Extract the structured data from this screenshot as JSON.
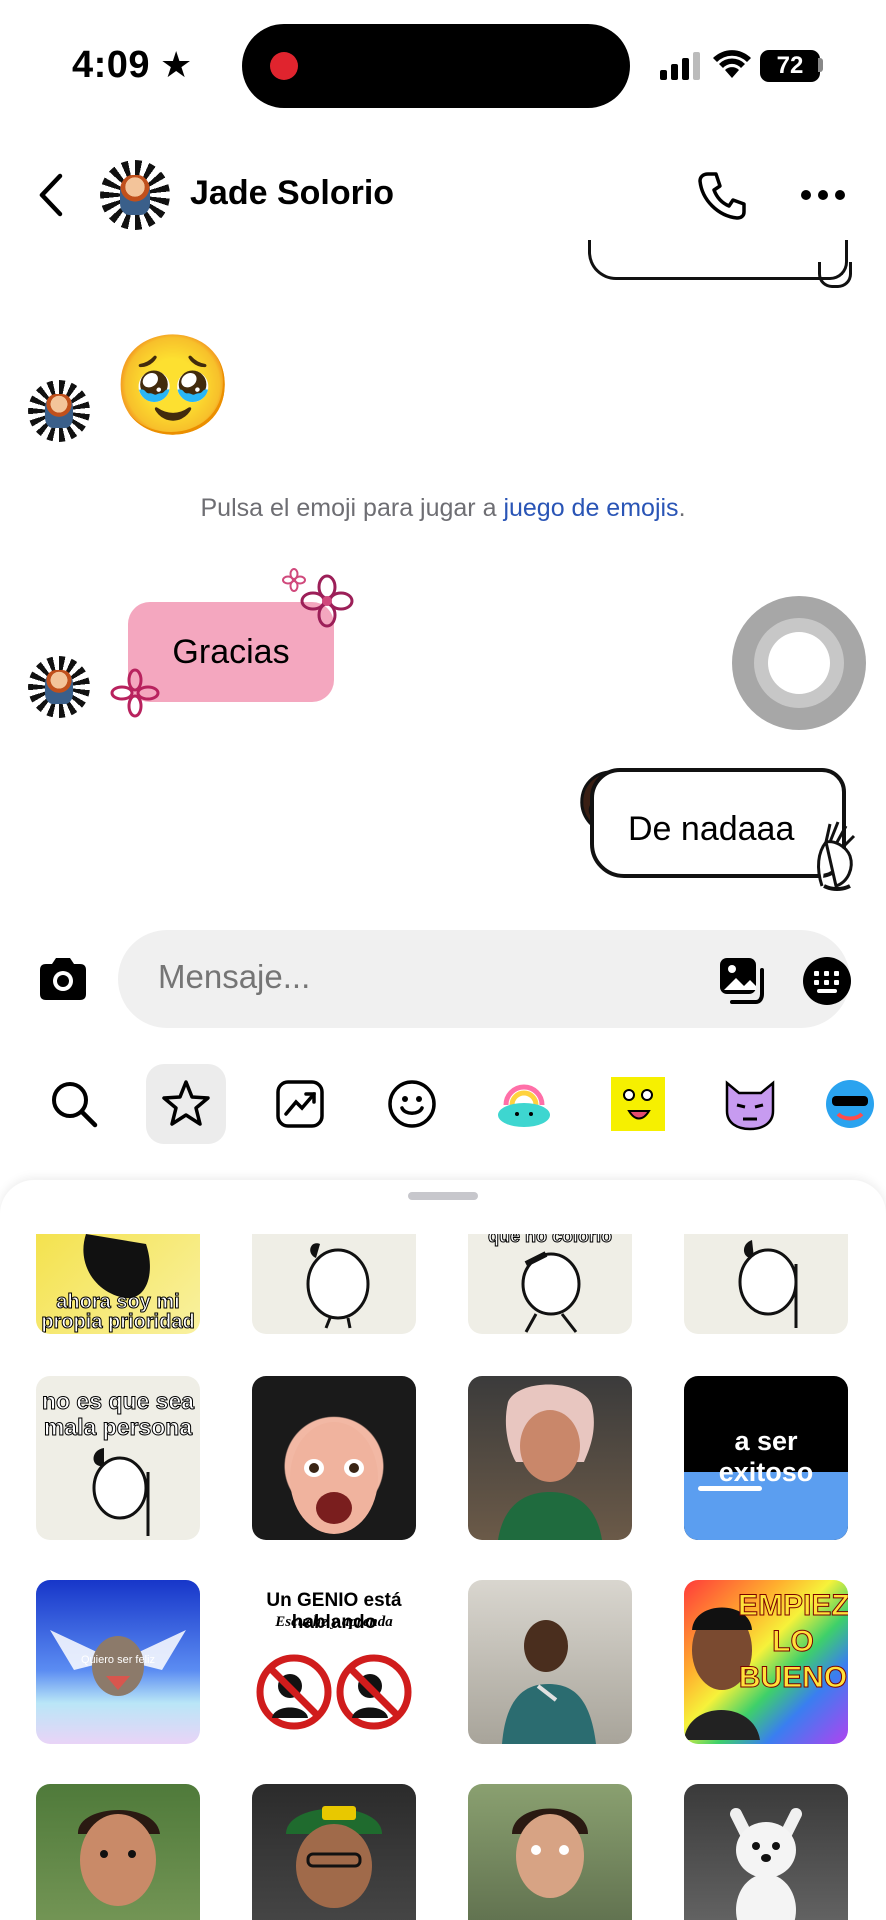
{
  "status_bar": {
    "time": "4:09",
    "battery": "72"
  },
  "header": {
    "contact_name": "Jade Solorio"
  },
  "messages": {
    "received_emoji": "🥹",
    "hint_prefix": "Pulsa el emoji para jugar a ",
    "hint_link": "juego de emojis",
    "hint_suffix": ".",
    "received_text": "Gracias",
    "sent_text": "De nadaaa"
  },
  "composer": {
    "placeholder": "Mensaje..."
  },
  "sticker_tabs": [
    "search-icon",
    "star-icon",
    "trending-icon",
    "emoji-icon",
    "rainbow-cloud-sticker",
    "yellow-face-sticker",
    "purple-cat-sticker",
    "blue-face-sticker"
  ],
  "sticker_grid": {
    "row1_captions": [
      "ahora soy mi propia prioridad",
      "",
      "que no colorio",
      ""
    ],
    "row2_captions": [
      "no es que sea mala persona",
      "",
      "",
      "a ser exitoso"
    ],
    "row3_captions": [
      "Quiero ser feliz",
      "Un GENIO está hablando",
      "",
      "EMPIEZA LO BUENO"
    ],
    "row3_subcaption": "Escuche y aprenda"
  },
  "colors": {
    "gracias_bubble": "#f4a7bf",
    "link": "#2a55b6",
    "hint": "#6e6e73"
  }
}
